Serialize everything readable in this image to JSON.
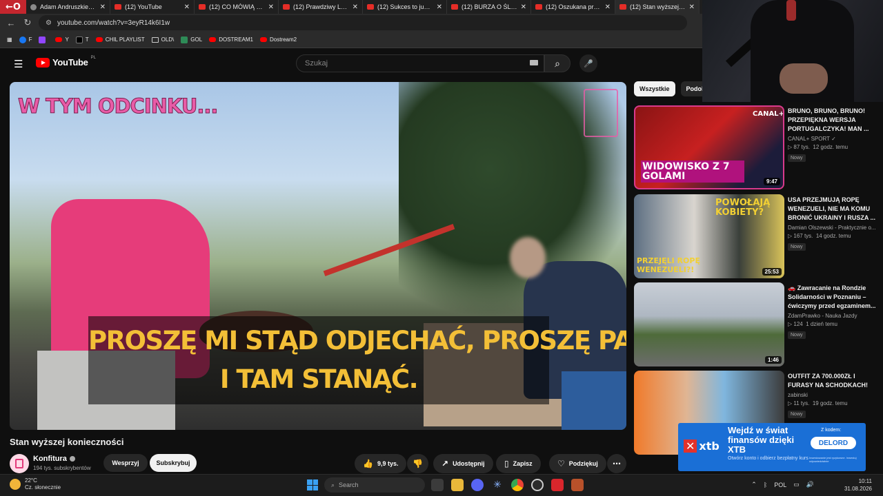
{
  "browser": {
    "tabs": [
      {
        "title": "Adam Andruszkiewic",
        "icon": "person-icon"
      },
      {
        "title": "(12) YouTube",
        "icon": "youtube-icon"
      },
      {
        "title": "(12) CO MÓWIĄ O TU",
        "icon": "youtube-icon"
      },
      {
        "title": "(12) Prawdziwy Lomb",
        "icon": "youtube-icon"
      },
      {
        "title": "(12) Sukces to już nie",
        "icon": "youtube-icon"
      },
      {
        "title": "(12) BURZA O ŚLUBY",
        "icon": "youtube-icon"
      },
      {
        "title": "(12) Oszukana prezen",
        "icon": "youtube-icon"
      },
      {
        "title": "(12) Stan wyższej kon",
        "icon": "youtube-icon"
      }
    ],
    "url": "youtube.com/watch?v=3eyR14k6I1w",
    "bookmarks": [
      {
        "label": "F",
        "icon": "facebook-icon"
      },
      {
        "label": "",
        "icon": "twitch-icon"
      },
      {
        "label": "Y",
        "icon": "youtube-icon"
      },
      {
        "label": "T",
        "icon": "x-icon"
      },
      {
        "label": "CHIL PLAYLIST",
        "icon": "youtube-icon"
      },
      {
        "label": "OLD\\",
        "icon": "folder-icon"
      },
      {
        "label": "GOL",
        "icon": "gol-icon"
      },
      {
        "label": "DOSTREAM1",
        "icon": "youtube-icon"
      },
      {
        "label": "Dostream2",
        "icon": "youtube-icon"
      }
    ]
  },
  "youtube": {
    "logo_text": "YouTube",
    "country_code": "PL",
    "search_placeholder": "Szukaj",
    "video": {
      "overlay_title": "W TYM ODCINKU...",
      "subtitle_line1": "PROSZĘ MI STĄD ODJECHAĆ, PROSZĘ PANA,",
      "subtitle_line2": "I TAM STANĄĆ.",
      "title": "Stan wyższej konieczności",
      "channel": "Konfitura",
      "subscribers": "194 tys. subskrybentów",
      "support_label": "Wesprzyj",
      "subscribe_label": "Subskrybuj",
      "likes": "9,9 tys.",
      "share_label": "Udostępnij",
      "save_label": "Zapisz",
      "thanks_label": "Podziękuj"
    },
    "chips": [
      "Wszystkie",
      "Podob"
    ],
    "recommendations": [
      {
        "title": "BRUNO, BRUNO, BRUNO! PRZEPIĘKNA WERSJA PORTUGALCZYKA! MAN ...",
        "channel": "CANAL+ SPORT",
        "views": "87 tys.",
        "age": "12 godz. temu",
        "badge": "Nowy",
        "duration": "9:47",
        "thumb_text": "WIDOWISKO Z 7 GOLAMI",
        "thumb_brand": "CANAL+"
      },
      {
        "title": "USA PRZEJMUJĄ ROPĘ WENEZUELI, NIE MA KOMU BRONIĆ UKRAINY I RUSZA ...",
        "channel": "Damian Olszewski - Praktycznie o...",
        "views": "167 tys.",
        "age": "14 godz. temu",
        "badge": "Nowy",
        "duration": "25:53",
        "thumb_text_top": "POWOŁAJĄ KOBIETY?",
        "thumb_text_bottom": "PRZEJĘLI ROPĘ WENEZUELI?!"
      },
      {
        "title": "🚗 Zawracanie na Rondzie Solidarności w Poznaniu – ćwiczymy przed egzaminem...",
        "channel": "ZdamPrawko - Nauka Jazdy",
        "views": "124",
        "age": "1 dzień temu",
        "badge": "Nowy",
        "duration": "1:46"
      },
      {
        "title": "OUTFIT ZA 700.000ZŁ I FURASY NA SCHODKACH!",
        "channel": "zabinski",
        "views": "11 tys.",
        "age": "19 godz. temu",
        "badge": "Nowy",
        "duration": ""
      }
    ]
  },
  "ad": {
    "brand": "xtb",
    "headline": "Wejdź w świat finansów dzięki XTB",
    "description": "Otwórz konto i odbierz bezpłatny kurs",
    "code_label": "Z kodem:",
    "code": "DELORD",
    "disclaimer": "Inwestowanie jest ryzykowne. Inwestuj odpowiedzialnie"
  },
  "taskbar": {
    "temperature": "22°C",
    "weather": "Cz. słonecznie",
    "search_placeholder": "Search",
    "language": "POL",
    "time": "10:11",
    "date": "31.08.2026"
  }
}
